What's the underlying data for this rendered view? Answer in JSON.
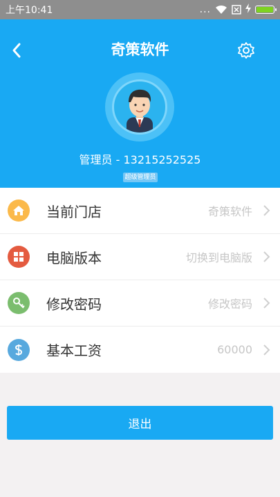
{
  "status_bar": {
    "time": "上午10:41",
    "dots": "..."
  },
  "header": {
    "title": "奇策软件",
    "user_line": "管理员 - 13215252525",
    "badge": "超级管理员"
  },
  "menu": [
    {
      "label": "当前门店",
      "value": "奇策软件",
      "icon": "home-icon",
      "color": "#fbb94a"
    },
    {
      "label": "电脑版本",
      "value": "切换到电脑版",
      "icon": "windows-icon",
      "color": "#e45b40"
    },
    {
      "label": "修改密码",
      "value": "修改密码",
      "icon": "key-icon",
      "color": "#7bbd6e"
    },
    {
      "label": "基本工资",
      "value": "60000",
      "icon": "dollar-icon",
      "color": "#58a9de"
    }
  ],
  "logout_label": "退出",
  "colors": {
    "primary": "#19a9f3",
    "statusbar": "#8e8e8e",
    "background": "#f3f1f2"
  }
}
